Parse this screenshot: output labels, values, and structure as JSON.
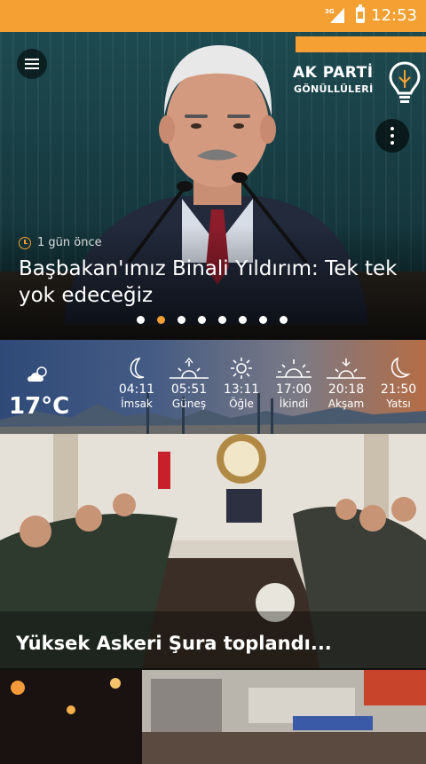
{
  "status_bar": {
    "network": "3G",
    "time": "12:53"
  },
  "brand": {
    "line1": "AK PARTİ",
    "line2": "GÖNÜLLÜLERİ"
  },
  "slider": {
    "time_ago": "1 gün önce",
    "headline": "Başbakan'ımız Binali Yıldırım: Tek tek yok edeceğiz",
    "dots_total": 8,
    "dots_active_index": 1
  },
  "weather": {
    "temperature": "17°C",
    "icon": "partly-cloudy-icon"
  },
  "prayer_times": [
    {
      "time": "04:11",
      "name": "İmsak",
      "icon": "crescent-moon-icon"
    },
    {
      "time": "05:51",
      "name": "Güneş",
      "icon": "sunrise-icon"
    },
    {
      "time": "13:11",
      "name": "Öğle",
      "icon": "sun-icon"
    },
    {
      "time": "17:00",
      "name": "İkindi",
      "icon": "low-sun-icon"
    },
    {
      "time": "20:18",
      "name": "Akşam",
      "icon": "sunset-icon"
    },
    {
      "time": "21:50",
      "name": "Yatsı",
      "icon": "night-moon-icon"
    }
  ],
  "news": [
    {
      "title": "Yüksek Askeri Şura toplandı..."
    }
  ],
  "colors": {
    "accent": "#f5a033"
  }
}
